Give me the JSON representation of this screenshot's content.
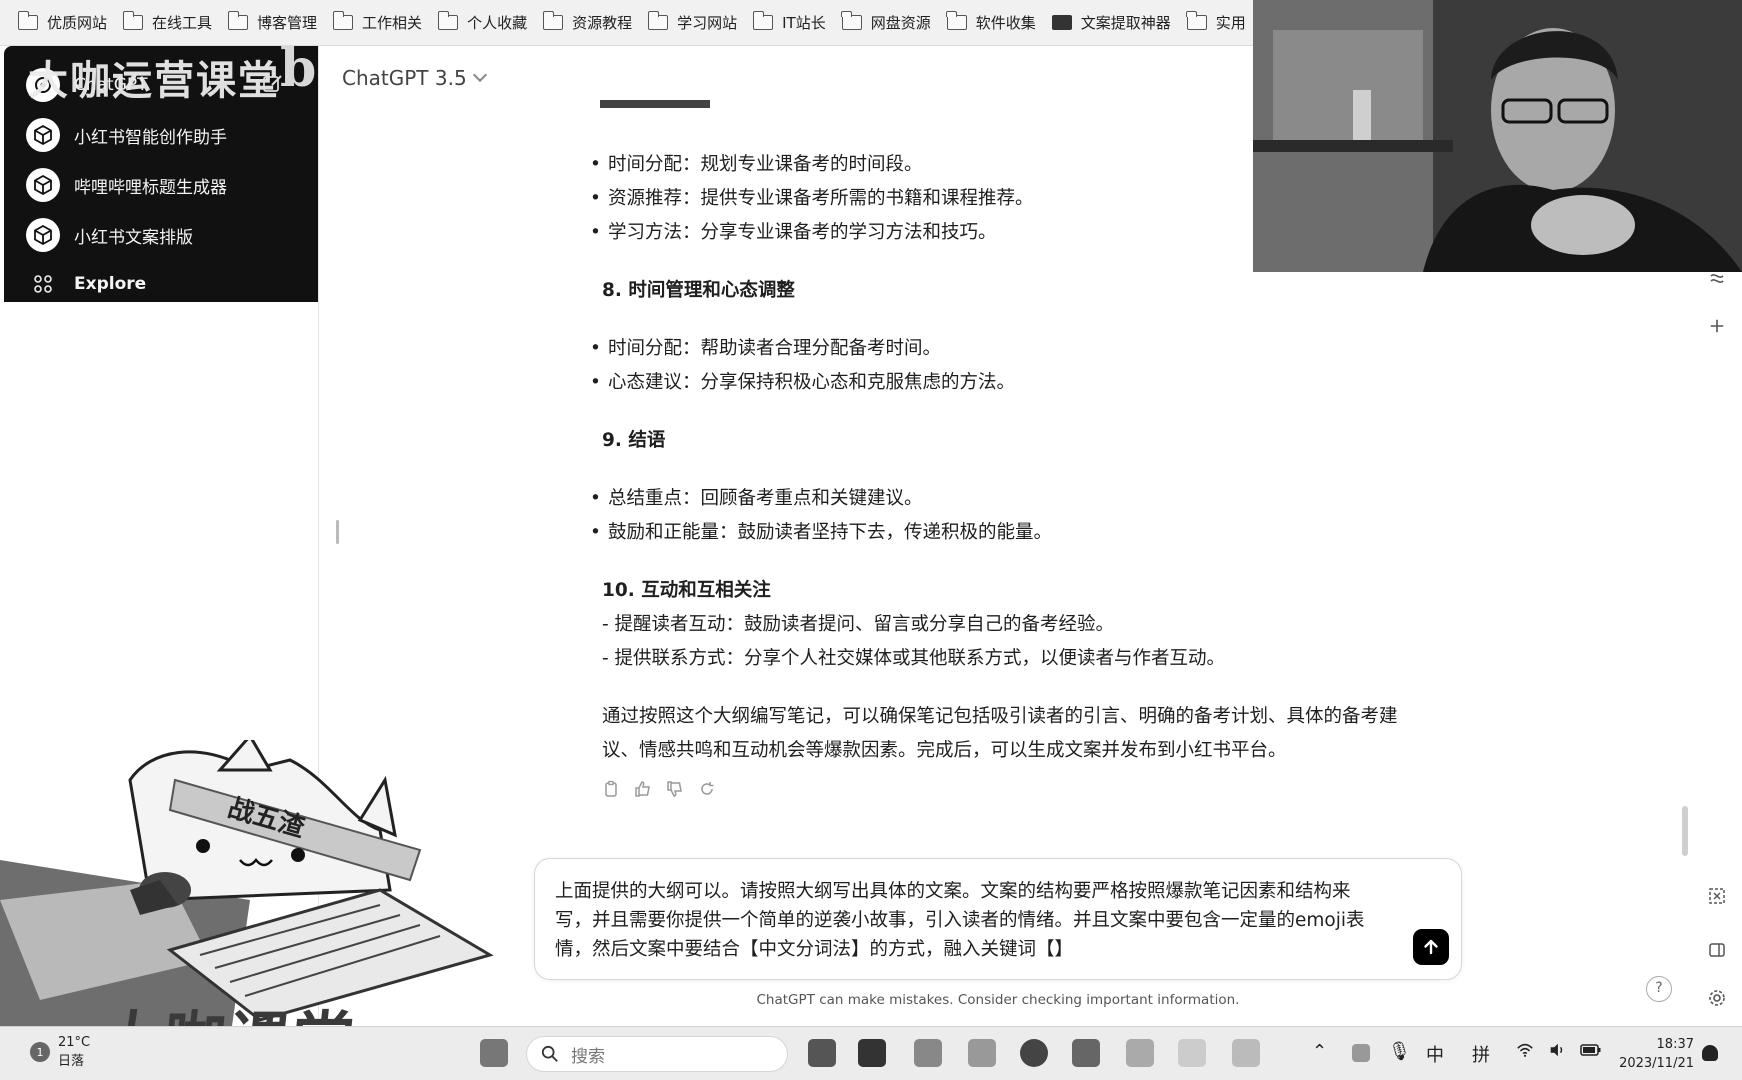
{
  "bookmarks": [
    "优质网站",
    "在线工具",
    "博客管理",
    "工作相关",
    "个人收藏",
    "资源教程",
    "学习网站",
    "IT站长",
    "网盘资源",
    "软件收集",
    "文案提取神器",
    "实用"
  ],
  "sidebar": {
    "brand": "大咖运营课堂",
    "brand_mark": "b",
    "items": [
      {
        "label": "ChatGPT"
      },
      {
        "label": "小红书智能创作助手"
      },
      {
        "label": "哔哩哔哩标题生成器"
      },
      {
        "label": "小红书文案排版"
      },
      {
        "label": "Explore"
      }
    ]
  },
  "header": {
    "model_label": "ChatGPT 3.5"
  },
  "content": {
    "section7_bullets": [
      "时间分配：规划专业课备考的时间段。",
      "资源推荐：提供专业课备考所需的书籍和课程推荐。",
      "学习方法：分享专业课备考的学习方法和技巧。"
    ],
    "section8_title": "8. 时间管理和心态调整",
    "section8_bullets": [
      "时间分配：帮助读者合理分配备考时间。",
      "心态建议：分享保持积极心态和克服焦虑的方法。"
    ],
    "section9_title": "9. 结语",
    "section9_bullets": [
      "总结重点：回顾备考重点和关键建议。",
      "鼓励和正能量：鼓励读者坚持下去，传递积极的能量。"
    ],
    "section10_title": "10. 互动和互相关注",
    "section10_lines": [
      "- 提醒读者互动：鼓励读者提问、留言或分享自己的备考经验。",
      "- 提供联系方式：分享个人社交媒体或其他联系方式，以便读者与作者互动。"
    ],
    "summary_lines": [
      "通过按照这个大纲编写笔记，可以确保笔记包括吸引读者的引言、明确的备考计划、具体的备考建",
      "议、情感共鸣和互动机会等爆款因素。完成后，可以生成文案并发布到小红书平台。"
    ]
  },
  "composer": {
    "lines": [
      "上面提供的大纲可以。请按照大纲写出具体的文案。文案的结构要严格按照爆款笔记因素和结构来",
      "写，并且需要你提供一个简单的逆袭小故事，引入读者的情绪。并且文案中要包含一定量的emoji表",
      "情，然后文案中要结合【中文分词法】的方式，融入关键词【】"
    ],
    "disclaimer": "ChatGPT can make mistakes. Consider checking important information."
  },
  "overlay": {
    "headband_text": "战五渣",
    "watermark": "大咖课堂"
  },
  "taskbar": {
    "weather_temp": "21°C",
    "weather_desc": "日落",
    "weather_badge": "1",
    "search_placeholder": "搜索",
    "ime_lang": "中",
    "ime_mode": "拼",
    "time": "18:37",
    "date": "2023/11/21"
  },
  "help_label": "?"
}
